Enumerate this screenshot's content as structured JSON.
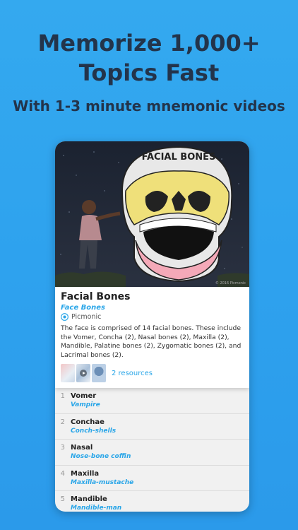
{
  "headline": {
    "line1": "Memorize 1,000+",
    "line2": "Topics Fast",
    "subtitle": "With 1-3 minute mnemonic videos"
  },
  "hero": {
    "art_title": "FACIAL BONES",
    "copyright": "© 2016 Picmonic"
  },
  "card": {
    "title": "Facial Bones",
    "subtitle": "Face Bones",
    "source": "Picmonic",
    "description": "The face is comprised of 14 facial bones. These include the Vomer, Concha (2), Nasal bones (2), Maxilla (2), Mandible, Palatine bones (2), Zygomatic bones (2), and Lacrimal bones (2).",
    "resources": "2 resources"
  },
  "list": [
    {
      "num": "1",
      "title": "Vomer",
      "mnemonic": "Vampire"
    },
    {
      "num": "2",
      "title": "Conchae",
      "mnemonic": "Conch-shells"
    },
    {
      "num": "3",
      "title": "Nasal",
      "mnemonic": "Nose-bone coffin"
    },
    {
      "num": "4",
      "title": "Maxilla",
      "mnemonic": "Maxilla-mustache"
    },
    {
      "num": "5",
      "title": "Mandible",
      "mnemonic": "Mandible-man"
    }
  ],
  "colors": {
    "background": "#2ea2ee",
    "headline": "#23344b",
    "accent": "#2aa6e8"
  },
  "icons": {
    "source": "eye-icon",
    "video": "play-icon"
  }
}
